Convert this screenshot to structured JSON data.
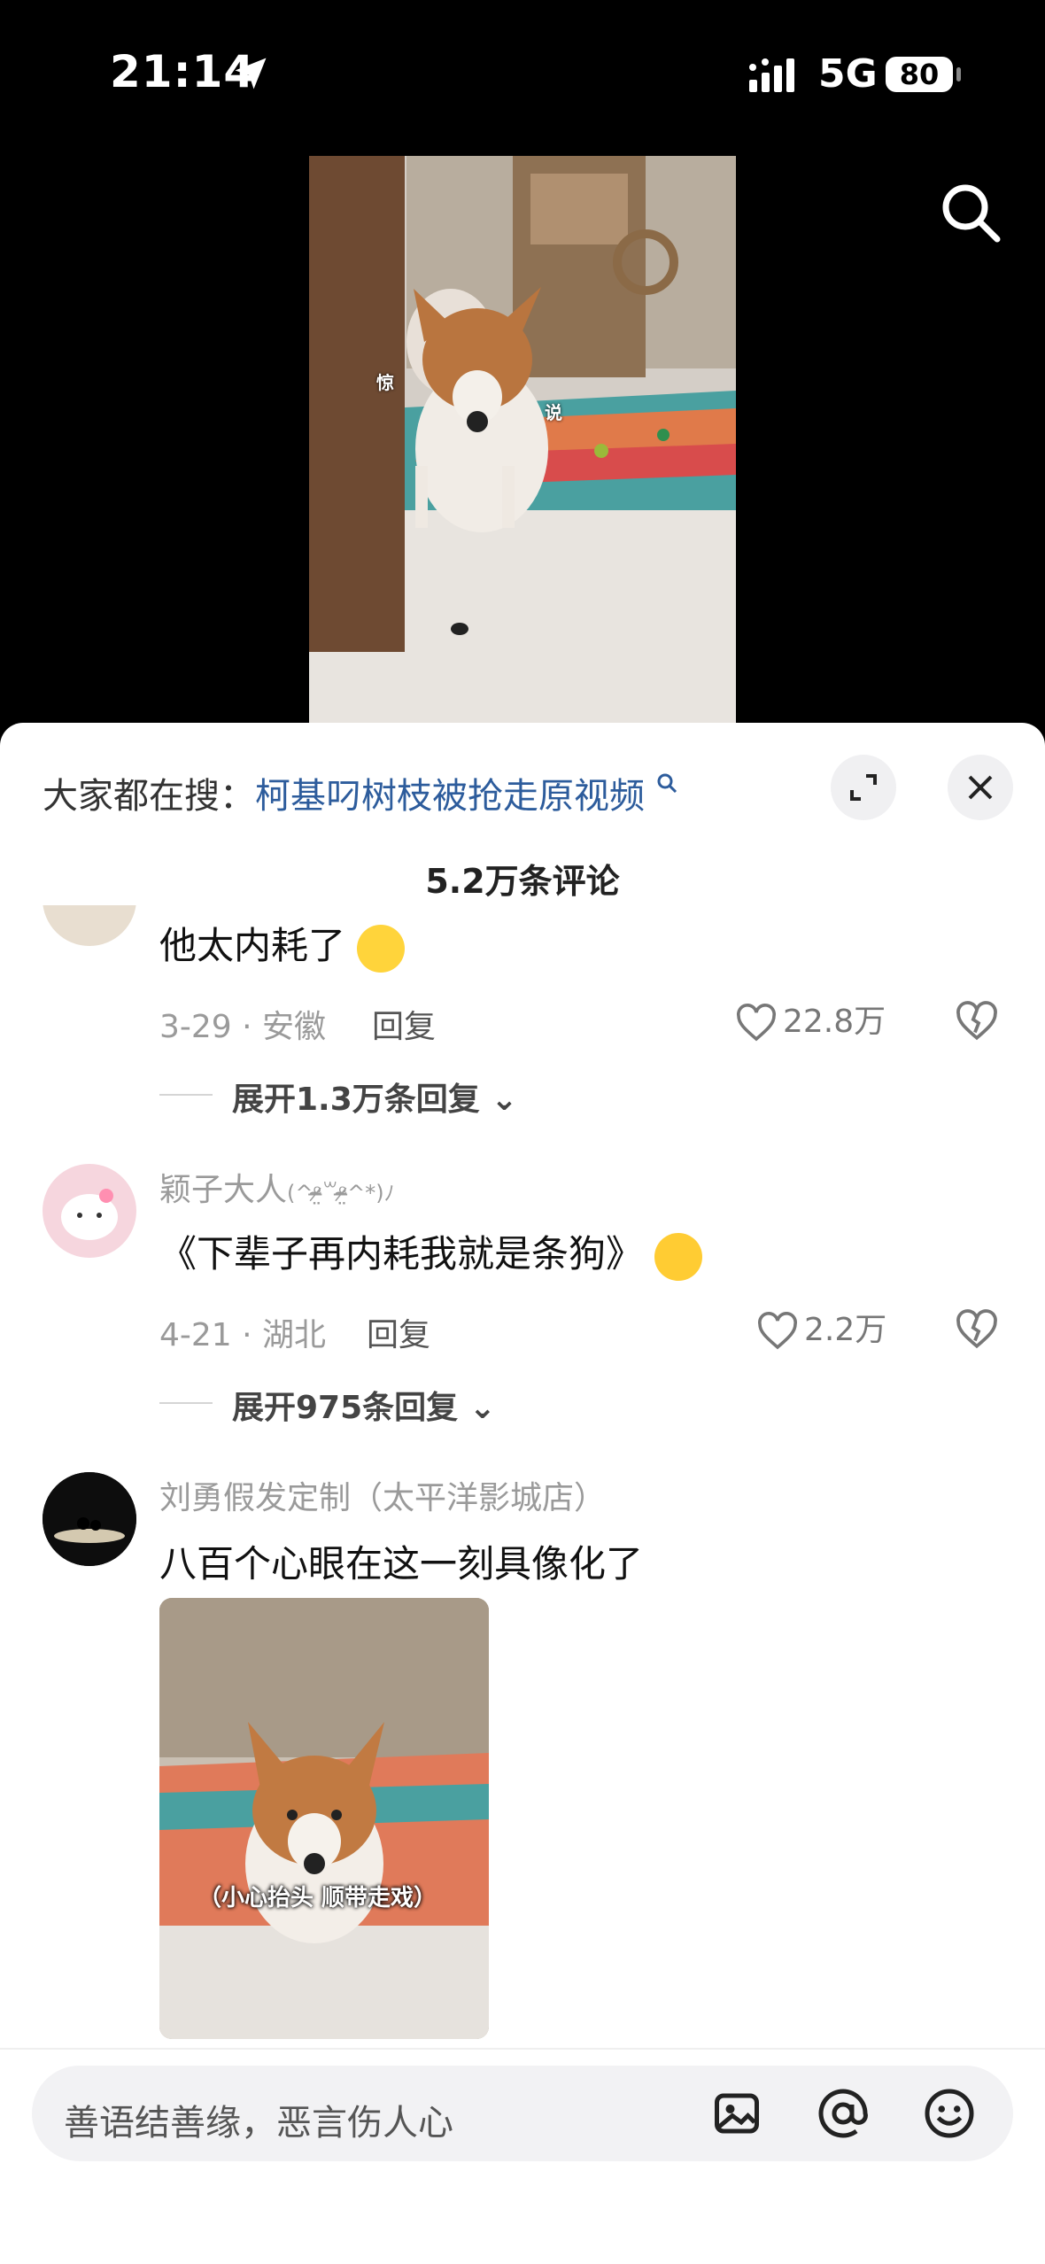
{
  "status_bar": {
    "time": "21:14",
    "network": "5G",
    "battery": "80"
  },
  "search_suggestion": {
    "prefix": "大家都在搜：",
    "keyword": "柯基叼树枝被抢走原视频"
  },
  "comments_header": {
    "count": "5.2万条评论"
  },
  "comments": [
    {
      "text": "他太内耗了",
      "date": "3-29",
      "location": "安徽",
      "reply_label": "回复",
      "likes": "22.8万",
      "expand_label": "展开1.3万条回复"
    },
    {
      "username": "颖子大人",
      "username_deco": "(^ᵒ̴̶̷̤꒳ᵒ̴̶̷̤^*)ﾉ",
      "text": "《下辈子再内耗我就是条狗》",
      "date": "4-21",
      "location": "湖北",
      "reply_label": "回复",
      "likes": "2.2万",
      "expand_label": "展开975条回复"
    },
    {
      "username": "刘勇假发定制（太平洋影城店）",
      "text": "八百个心眼在这一刻具像化了",
      "image_caption": "（小心抬头 顺带走戏）"
    }
  ],
  "video": {
    "caption_left": "惊",
    "caption_right": "说"
  },
  "input_bar": {
    "placeholder": "善语结善缘，恶言伤人心"
  },
  "icons": [
    "location-arrow-icon",
    "signal-icon",
    "search-icon",
    "expand-icon",
    "close-icon",
    "heart-icon",
    "broken-heart-icon",
    "image-icon",
    "at-icon",
    "emoji-icon"
  ]
}
